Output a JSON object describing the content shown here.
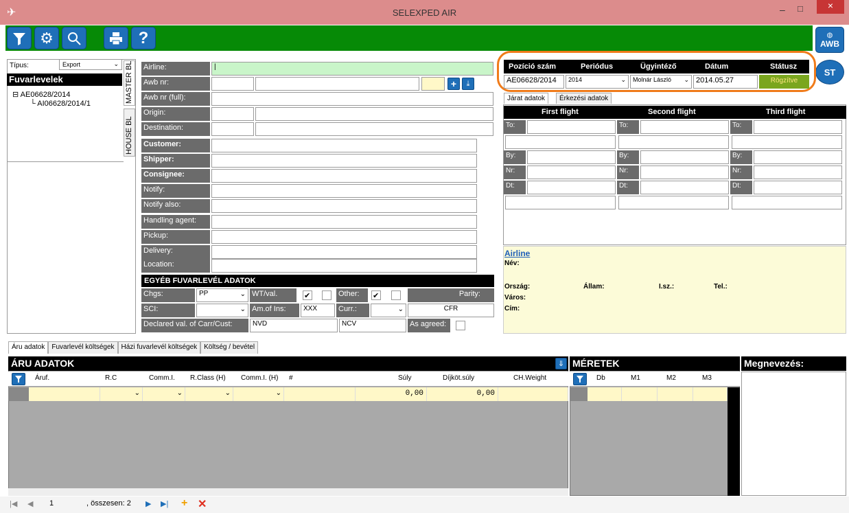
{
  "window": {
    "title": "SELEXPED AIR",
    "min": "–",
    "max": "□",
    "close": "×"
  },
  "awb_btn": "AWB",
  "st_btn": "ST",
  "left": {
    "type_label": "Típus:",
    "type_value": "Export",
    "tree_title": "Fuvarlevelek",
    "tree_root": "AE06628/2014",
    "tree_child": "AI06628/2014/1",
    "master_tab": "MASTER BL",
    "house_tab": "HOUSE BL"
  },
  "form": {
    "airline": "Airline:",
    "awb_nr": "Awb nr:",
    "awb_full": "Awb nr (full):",
    "origin": "Origin:",
    "destination": "Destination:",
    "customer": "Customer:",
    "shipper": "Shipper:",
    "consignee": "Consignee:",
    "notify": "Notify:",
    "notify_also": "Notify also:",
    "handling": "Handling agent:",
    "pickup": "Pickup:",
    "delivery": "Delivery:",
    "location": "Location:"
  },
  "other": {
    "title": "EGYÉB FUVARLEVÉL ADATOK",
    "chgs": "Chgs:",
    "chgs_val": "PP",
    "wt": "WT/val.",
    "other": "Other:",
    "parity": "Parity:",
    "sci": "SCI:",
    "amins": "Am.of Ins:",
    "amins_val": "XXX",
    "curr": "Curr.:",
    "parity_val": "CFR",
    "declared": "Declared val. of Carr/Cust:",
    "nvd": "NVD",
    "ncv": "NCV",
    "asagreed": "As agreed:"
  },
  "pos": {
    "h_pos": "Pozíció szám",
    "h_per": "Periódus",
    "h_ugy": "Ügyintéző",
    "h_dat": "Dátum",
    "h_stat": "Státusz",
    "pos": "AE06628/2014",
    "per": "2014",
    "ugy": "Molnár László",
    "dat": "2014.05.27",
    "stat": "Rögzítve"
  },
  "flight": {
    "tab1": "Járat adatok",
    "tab2": "Érkezési adatok",
    "first": "First flight",
    "second": "Second flight",
    "third": "Third flight",
    "to": "To:",
    "by": "By:",
    "nr": "Nr:",
    "dt": "Dt:"
  },
  "airline_info": {
    "title": "Airline",
    "nev": "Név:",
    "orszag": "Ország:",
    "allam": "Állam:",
    "isz": "I.sz.:",
    "tel": "Tel.:",
    "varos": "Város:",
    "cim": "Cím:"
  },
  "bottom_tabs": [
    "Áru adatok",
    "Fuvarlevél költségek",
    "Házi fuvarlevél költségek",
    "Költség / bevétel"
  ],
  "aru": {
    "title": "ÁRU ADATOK",
    "cols": [
      "Áruf.",
      "R.C",
      "Comm.I.",
      "R.Class (H)",
      "Comm.I. (H)",
      "#",
      "Súly",
      "Díjköt.súly",
      "CH.Weight"
    ],
    "suly": "0,00",
    "dijkot": "0,00"
  },
  "meretek": {
    "title": "MÉRETEK",
    "cols": [
      "Db",
      "M1",
      "M2",
      "M3"
    ]
  },
  "megnev": {
    "title": "Megnevezés:"
  },
  "nav": {
    "page": "1",
    "total": ", összesen: 2"
  },
  "colors": {
    "titlebar": "#dc8c8c",
    "green": "#068a06",
    "orange": "#f07b1a",
    "status": "#7aa61e"
  }
}
